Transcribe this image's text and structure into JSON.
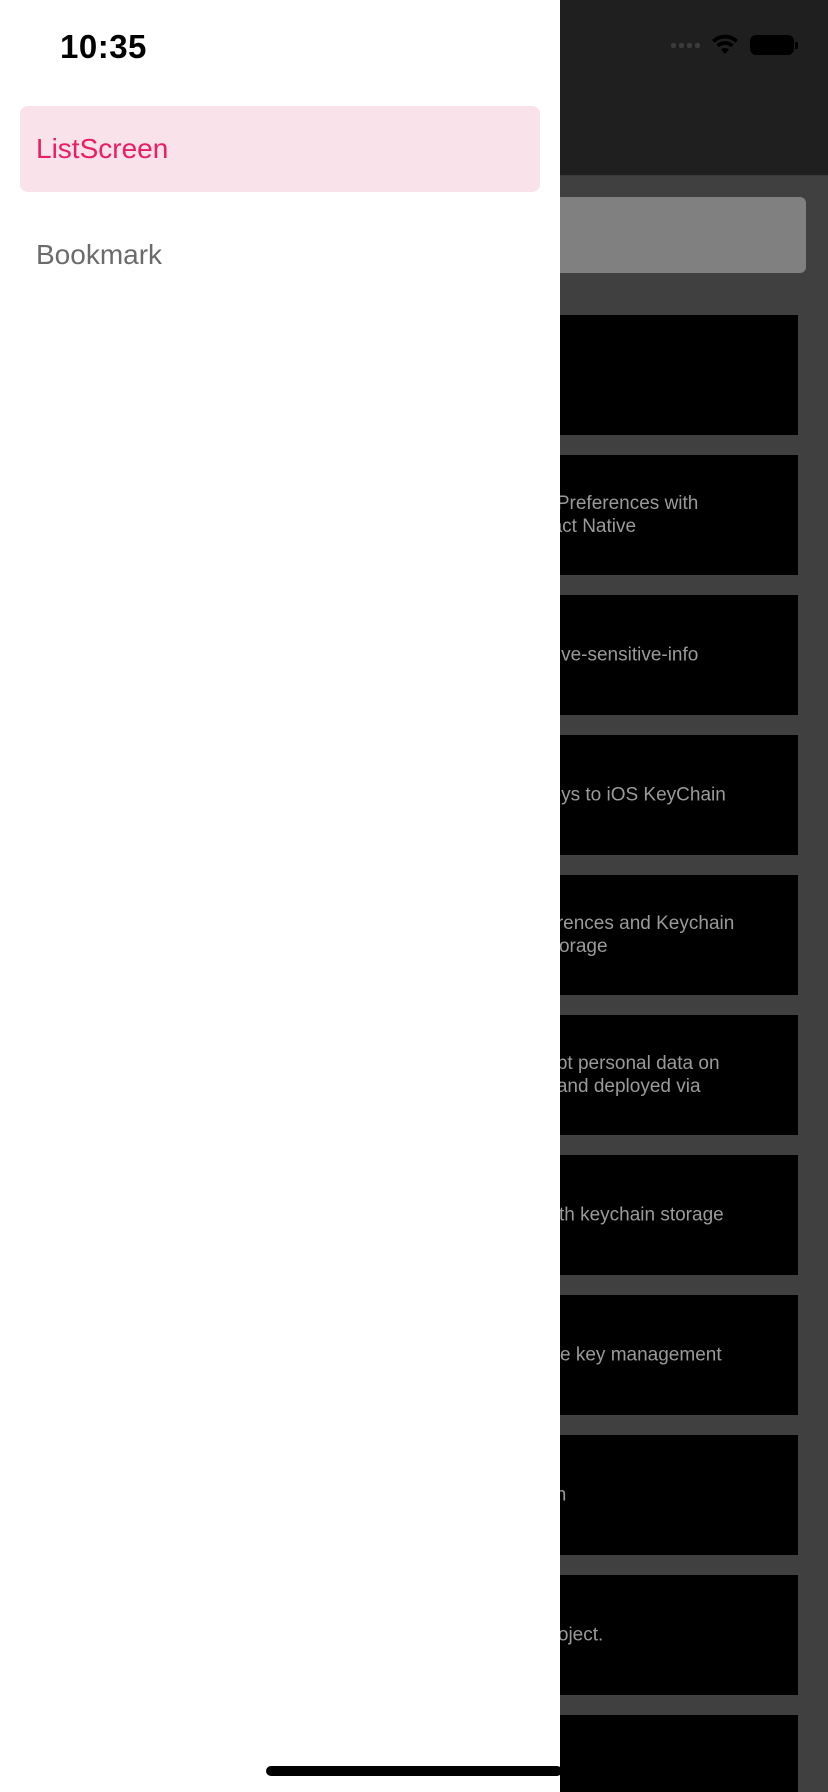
{
  "status_bar": {
    "time": "10:35",
    "wifi_icon": "wifi-icon",
    "battery_icon": "battery-icon"
  },
  "drawer": {
    "items": [
      {
        "label": "ListScreen",
        "active": true
      },
      {
        "label": "Bookmark",
        "active": false
      }
    ],
    "active_color": "#e91e63",
    "active_bg": "#f9e2ea"
  },
  "background_list": {
    "cards": [
      {
        "text": ""
      },
      {
        "text": "d Preferences with\neact Native"
      },
      {
        "text": "ative-sensitive-info"
      },
      {
        "text": " keys to iOS KeyChain"
      },
      {
        "text": "ferences and Keychain\nStorage"
      },
      {
        "text": "rypt personal data on\nd and deployed via"
      },
      {
        "text": "with keychain storage"
      },
      {
        "text": "bile key management"
      },
      {
        "text": "ain"
      },
      {
        "text": " project."
      },
      {
        "text": ""
      }
    ]
  }
}
